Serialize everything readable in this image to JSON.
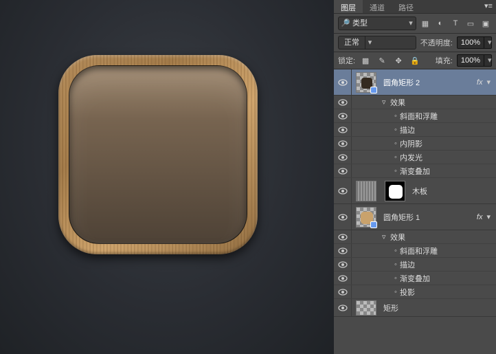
{
  "tabs": {
    "layers": "图层",
    "channels": "通道",
    "paths": "路径"
  },
  "filter": {
    "type": "类型"
  },
  "blend": {
    "mode": "正常",
    "opacity_label": "不透明度:",
    "opacity_value": "100%"
  },
  "lock": {
    "label": "锁定:",
    "fill_label": "填充:",
    "fill_value": "100%"
  },
  "layers": [
    {
      "name": "圆角矩形 2",
      "fx_label": "fx",
      "effects_label": "效果",
      "effects": [
        "斜面和浮雕",
        "描边",
        "内阴影",
        "内发光",
        "渐变叠加"
      ]
    },
    {
      "name": "木板"
    },
    {
      "name": "圆角矩形 1",
      "fx_label": "fx",
      "effects_label": "效果",
      "effects": [
        "斜面和浮雕",
        "描边",
        "渐变叠加",
        "投影"
      ]
    },
    {
      "name": "矩形"
    }
  ]
}
